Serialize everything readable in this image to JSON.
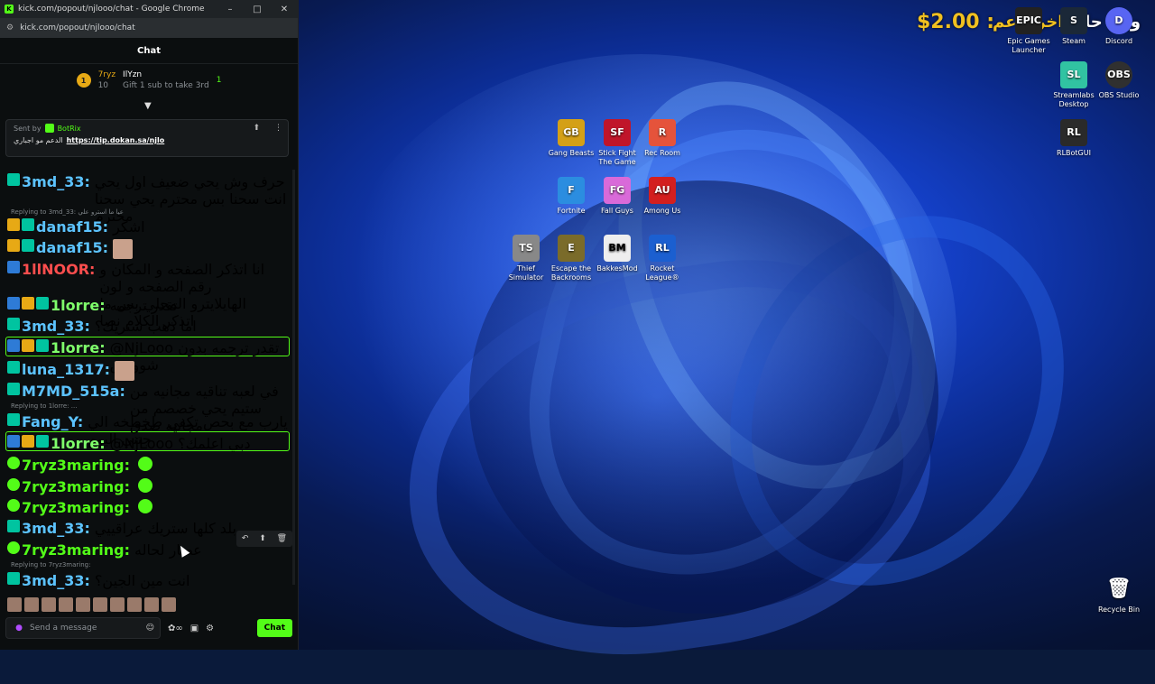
{
  "window": {
    "title": "kick.com/popout/njlooo/chat - Google Chrome",
    "url": "kick.com/popout/njlooo/chat",
    "controls": [
      "–",
      "□",
      "✕"
    ]
  },
  "chat": {
    "header": "Chat",
    "gifters": [
      {
        "rank": "1",
        "name": "7ryz",
        "count": "10"
      },
      {
        "name": "IlYzn",
        "count": "1"
      }
    ],
    "gift_hint": "Gift 1 sub to take 3rd",
    "pinned": {
      "sent_by_label": "Sent by",
      "bot": "BotRix",
      "text": "الدعم مو اجباري",
      "link": "https://tip.dokan.sa/njlo"
    },
    "messages": [
      {
        "user": "3md_33:",
        "text": "حرف وش يحي ضعيف اول يحي انت سحنا بس محترم يحي سحنا محترم"
      },
      {
        "reply": "Replying to 3md_33: عيا ما استرو علي",
        "user": "danaf15:",
        "text": "اشكر"
      },
      {
        "user": "danaf15:",
        "text": ""
      },
      {
        "user": "1llNOOR:",
        "text": "انا اتذكر الصفحه و المكان و رقم الصفحه و لون الهايلايترو المحلي بس ما اتذكر الكلام نصا"
      },
      {
        "user": "1lorre:",
        "text": "تقدر ترجمه"
      },
      {
        "user": "3md_33:",
        "text": "اما ذهب ستريك؟"
      },
      {
        "user": "1lorre:",
        "text": "@NjLooo تقدر ترجمه بدون شوويس"
      },
      {
        "user": "luna_1317:",
        "text": ""
      },
      {
        "user": "M7MD_515a:",
        "text": "في لعبه تناقيه مجانيه من ستيم يحي خصصم من مجانيه صدق"
      },
      {
        "reply": "Replying to 1lorre: ...",
        "user": "Fang_Y:",
        "text": "يارب مع بحص تكفى طخطخه الي جتني اليوم"
      },
      {
        "user": "1lorre:",
        "text": "@NjLooo دبي اعلمك؟"
      },
      {
        "user": "7ryz3maring:",
        "text": ""
      },
      {
        "user": "7ryz3maring:",
        "text": ""
      },
      {
        "user": "7ryz3maring:",
        "text": ""
      },
      {
        "user": "3md_33:",
        "text": "بلد كلها ستريك عراقييي"
      },
      {
        "user": "7ryz3maring:",
        "text": "عصار لحاله"
      },
      {
        "reply": "Replying to 7ryz3maring:",
        "user": "3md_33:",
        "text": "انت مين الجين؟"
      }
    ],
    "input_placeholder": "Send a message",
    "send_label": "Chat"
  },
  "desktop": {
    "overlay_price": "$2.00 :",
    "overlay_ar": "اخر داعم",
    "overlay_tail": "وش حلتنا",
    "icons": [
      {
        "label": "Epic Games Launcher",
        "short": "EPIC",
        "color": "#222222"
      },
      {
        "label": "Steam",
        "short": "S",
        "color": "#1b2838"
      },
      {
        "label": "Discord",
        "short": "D",
        "color": "#5865f2"
      },
      {
        "label": "Streamlabs Desktop",
        "short": "SL",
        "color": "#31c3a2"
      },
      {
        "label": "OBS Studio",
        "short": "OBS",
        "color": "#303030"
      },
      {
        "label": "RLBotGUI",
        "short": "RL",
        "color": "#2a2a2a"
      },
      {
        "label": "Gang Beasts",
        "short": "GB",
        "color": "#d4a017"
      },
      {
        "label": "Stick Fight The Game",
        "short": "SF",
        "color": "#c0152a"
      },
      {
        "label": "Rec Room",
        "short": "R",
        "color": "#e5533b"
      },
      {
        "label": "Fortnite",
        "short": "F",
        "color": "#2b8de0"
      },
      {
        "label": "Fall Guys",
        "short": "FG",
        "color": "#d96ad9"
      },
      {
        "label": "Among Us",
        "short": "AU",
        "color": "#d31f1f"
      },
      {
        "label": "Thief Simulator",
        "short": "TS",
        "color": "#888888"
      },
      {
        "label": "Escape the Backrooms",
        "short": "E",
        "color": "#7a6b2a"
      },
      {
        "label": "BakkesMod",
        "short": "BM",
        "color": "#eeeeee"
      },
      {
        "label": "Rocket League®",
        "short": "RL",
        "color": "#1b5fd0"
      },
      {
        "label": "Recycle Bin",
        "short": "🗑",
        "color": "#6fa8dc"
      }
    ]
  }
}
